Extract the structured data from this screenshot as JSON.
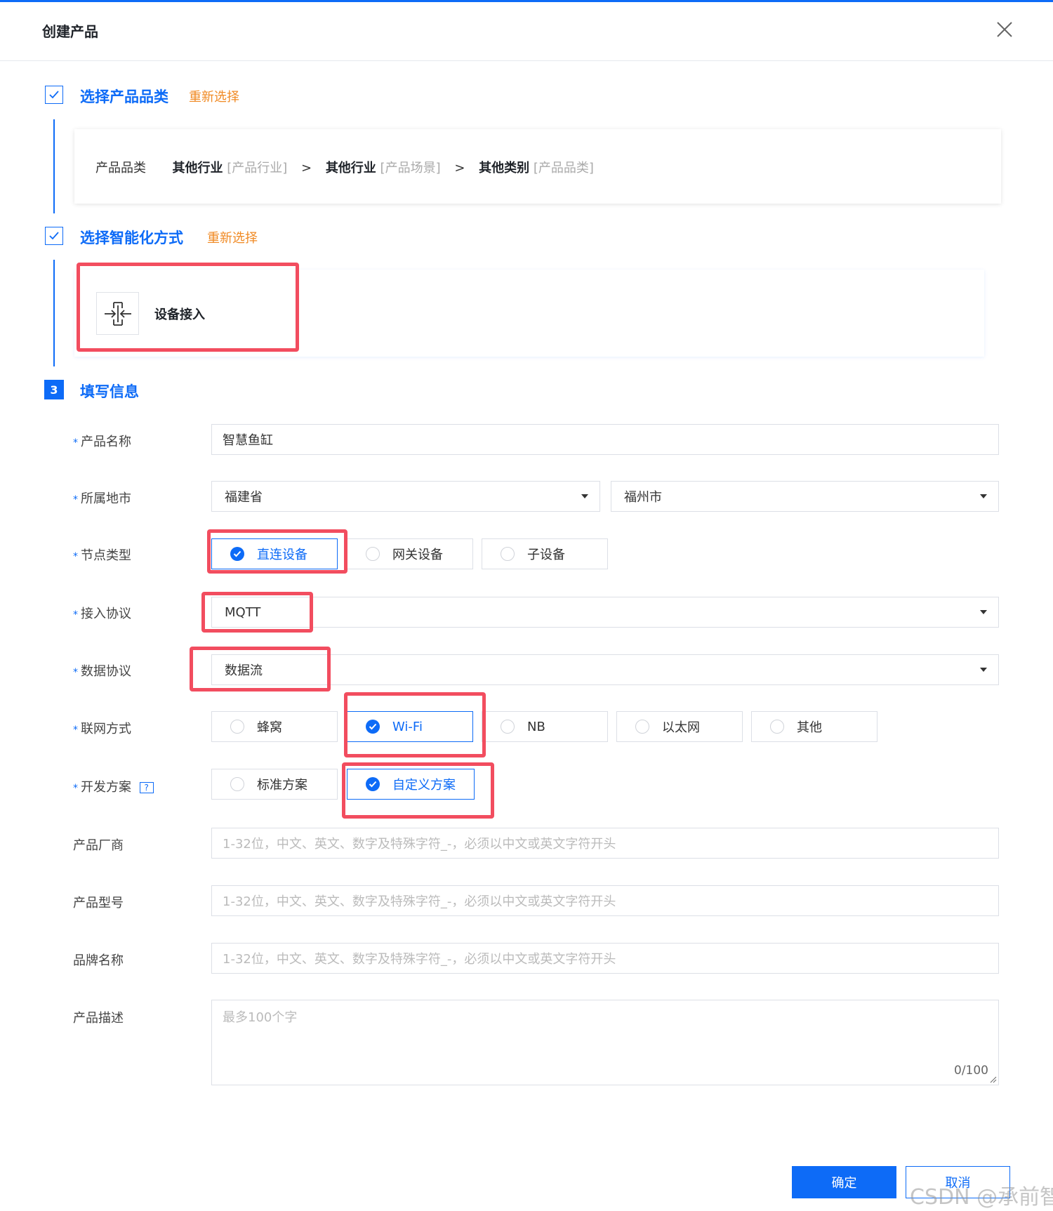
{
  "dialog": {
    "title": "创建产品"
  },
  "steps": {
    "step1": {
      "title": "选择产品品类",
      "reselect": "重新选择",
      "category_label": "产品品类",
      "path": [
        {
          "name": "其他行业",
          "tag": "[产品行业]"
        },
        {
          "name": "其他行业",
          "tag": "[产品场景]"
        },
        {
          "name": "其他类别",
          "tag": "[产品品类]"
        }
      ],
      "separator": ">"
    },
    "step2": {
      "title": "选择智能化方式",
      "reselect": "重新选择",
      "method": "设备接入"
    },
    "step3": {
      "number": "3",
      "title": "填写信息"
    }
  },
  "form": {
    "required_mark": "*",
    "product_name": {
      "label": "产品名称",
      "value": "智慧鱼缸"
    },
    "location": {
      "label": "所属地市",
      "province": "福建省",
      "city": "福州市"
    },
    "node_type": {
      "label": "节点类型",
      "options": [
        "直连设备",
        "网关设备",
        "子设备"
      ],
      "selected": "直连设备"
    },
    "access_protocol": {
      "label": "接入协议",
      "value": "MQTT"
    },
    "data_protocol": {
      "label": "数据协议",
      "value": "数据流"
    },
    "network": {
      "label": "联网方式",
      "options": [
        "蜂窝",
        "Wi-Fi",
        "NB",
        "以太网",
        "其他"
      ],
      "selected": "Wi-Fi"
    },
    "dev_plan": {
      "label": "开发方案",
      "help": "?",
      "options": [
        "标准方案",
        "自定义方案"
      ],
      "selected": "自定义方案"
    },
    "vendor": {
      "label": "产品厂商",
      "placeholder": "1-32位，中文、英文、数字及特殊字符_-，必须以中文或英文字符开头"
    },
    "model": {
      "label": "产品型号",
      "placeholder": "1-32位，中文、英文、数字及特殊字符_-，必须以中文或英文字符开头"
    },
    "brand": {
      "label": "品牌名称",
      "placeholder": "1-32位，中文、英文、数字及特殊字符_-，必须以中文或英文字符开头"
    },
    "description": {
      "label": "产品描述",
      "placeholder": "最多100个字",
      "counter": "0/100"
    }
  },
  "footer": {
    "confirm": "确定",
    "cancel": "取消"
  },
  "watermark": "CSDN @承前智",
  "colors": {
    "primary": "#0d6bf7",
    "accent": "#f08a24",
    "highlight": "#f24d5f"
  }
}
